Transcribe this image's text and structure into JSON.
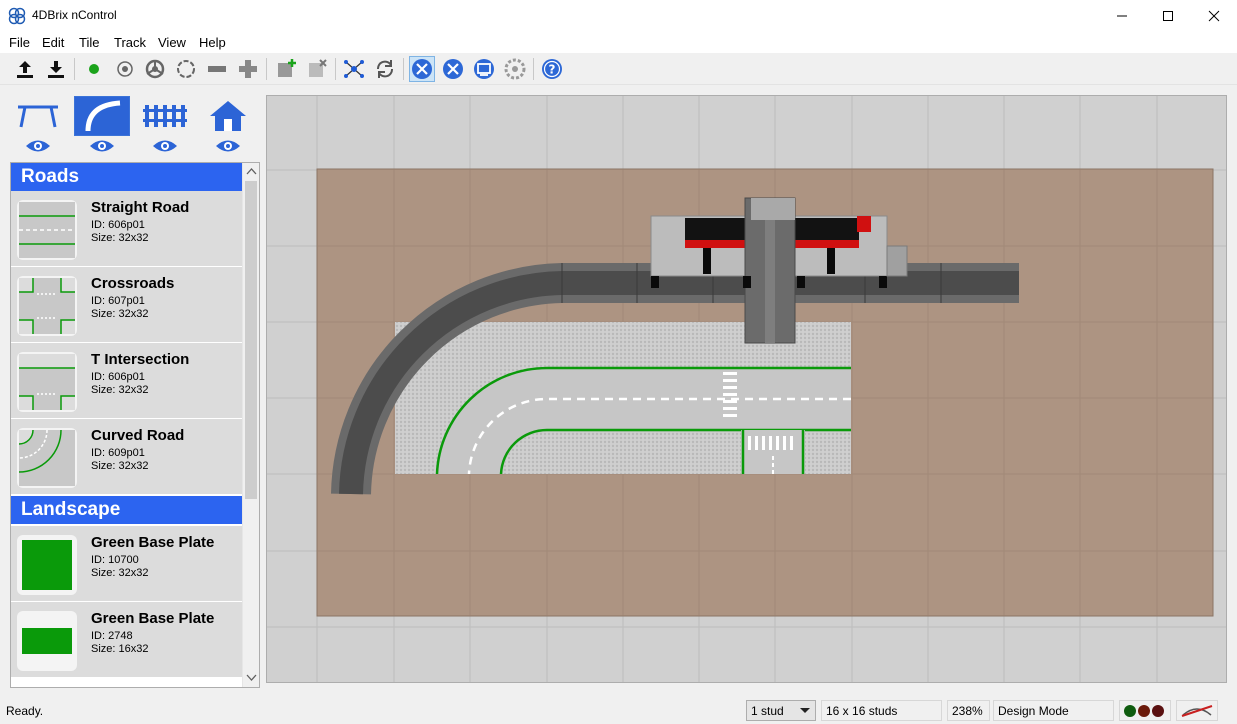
{
  "window": {
    "title": "4DBrix nControl"
  },
  "menu": [
    "File",
    "Edit",
    "Tile",
    "Track",
    "View",
    "Help"
  ],
  "toolbar": [
    "upload-icon",
    "download-icon",
    "green-dot-icon",
    "sensor-icon",
    "turntable-icon",
    "loop-icon",
    "rail-icon",
    "crossing-icon",
    "add-tile-icon",
    "remove-tile-icon",
    "network-icon",
    "refresh-icon",
    "design-tools-icon",
    "tools-icon",
    "display-icon",
    "settings-icon",
    "help-icon"
  ],
  "categories": [
    {
      "name": "track-category-icon",
      "active": false
    },
    {
      "name": "road-category-icon",
      "active": true
    },
    {
      "name": "fence-category-icon",
      "active": false
    },
    {
      "name": "house-category-icon",
      "active": false
    }
  ],
  "palette": {
    "sections": [
      {
        "title": "Roads",
        "items": [
          {
            "name": "Straight Road",
            "id": "ID: 606p01",
            "size": "Size: 32x32"
          },
          {
            "name": "Crossroads",
            "id": "ID: 607p01",
            "size": "Size: 32x32"
          },
          {
            "name": "T Intersection",
            "id": "ID: 606p01",
            "size": "Size: 32x32"
          },
          {
            "name": "Curved Road",
            "id": "ID: 609p01",
            "size": "Size: 32x32"
          }
        ]
      },
      {
        "title": "Landscape",
        "items": [
          {
            "name": "Green Base Plate",
            "id": "ID: 10700",
            "size": "Size: 32x32"
          },
          {
            "name": "Green Base Plate",
            "id": "ID: 2748",
            "size": "Size: 16x32"
          }
        ]
      }
    ]
  },
  "status": {
    "message": "Ready.",
    "grid_option": "1 stud",
    "tile_size": "16 x 16 studs",
    "zoom": "238%",
    "mode": "Design Mode",
    "lights": [
      "#0f5c0f",
      "#6b1a0a",
      "#5a1010"
    ]
  },
  "colors": {
    "accent": "#2c64f0",
    "baseplate": "#ad9482",
    "road": "#555555",
    "green_line": "#0a9a0a"
  }
}
